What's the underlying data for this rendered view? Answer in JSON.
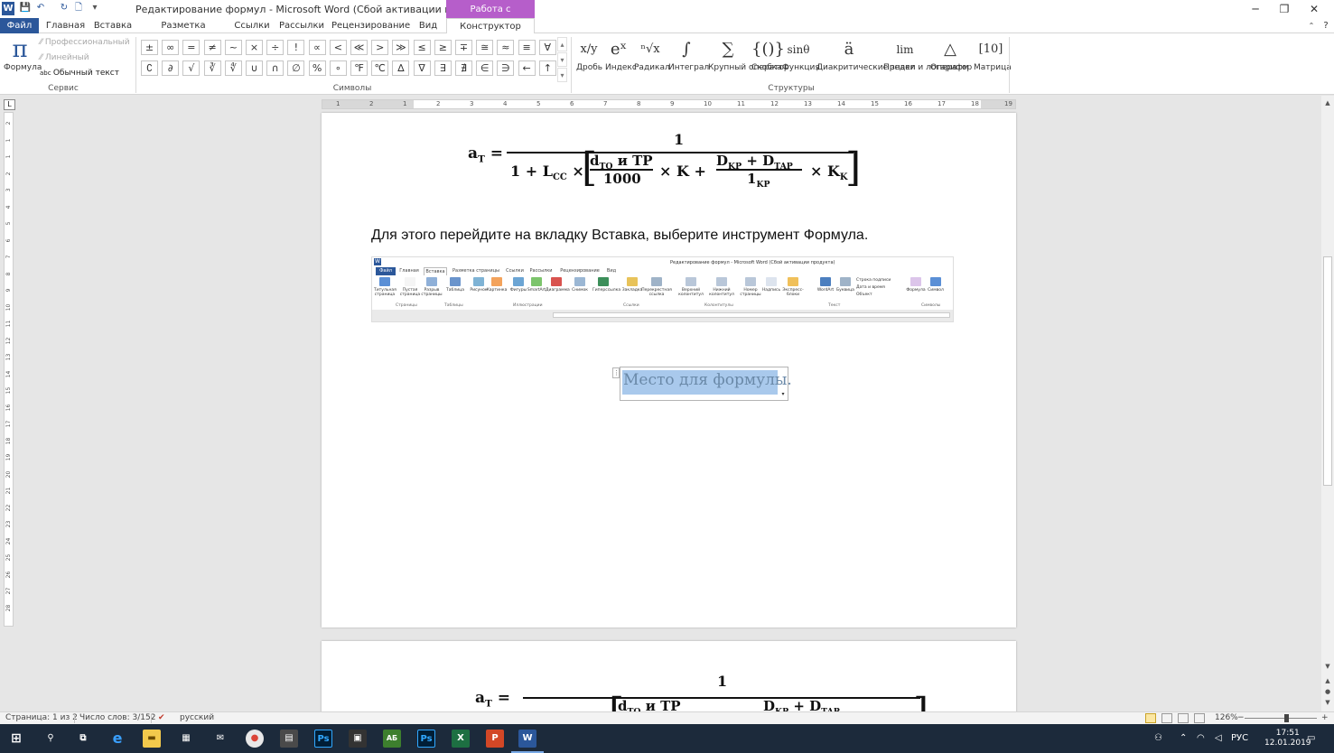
{
  "window": {
    "title": "Редактирование формул  -  Microsoft Word (Сбой активации продукта)",
    "context_group": "Работа с формулами",
    "buttons": [
      "─",
      "❐",
      "✕"
    ]
  },
  "quick_access": {
    "logo": "W",
    "save": "💾",
    "undo": "↶",
    "repeat": "↻",
    "new": "🗋",
    "customize": "▾"
  },
  "tabs": [
    "Файл",
    "Главная",
    "Вставка",
    "Разметка страницы",
    "Ссылки",
    "Рассылки",
    "Рецензирование",
    "Вид",
    "Конструктор"
  ],
  "ribbon": {
    "service": {
      "formula_icon": "π",
      "formula_label": "Формула",
      "professional": "Профессиональный",
      "linear": "Линейный",
      "normal_text": "Обычный текст",
      "group_label": "Сервис"
    },
    "symbols": {
      "row1": [
        "±",
        "∞",
        "=",
        "≠",
        "~",
        "×",
        "÷",
        "!",
        "∝",
        "<",
        "≪",
        ">",
        "≫",
        "≤",
        "≥",
        "∓",
        "≅",
        "≈",
        "≡",
        "∀"
      ],
      "row2": [
        "∁",
        "∂",
        "√",
        "∛",
        "∜",
        "∪",
        "∩",
        "∅",
        "%",
        "∘",
        "℉",
        "℃",
        "∆",
        "∇",
        "∃",
        "∄",
        "∈",
        "∋",
        "←",
        "↑"
      ],
      "group_label": "Символы"
    },
    "structures": {
      "items": [
        {
          "icon": "x/y",
          "label": "Дробь"
        },
        {
          "icon": "eˣ",
          "label": "Индекс"
        },
        {
          "icon": "ⁿ√x",
          "label": "Радикал"
        },
        {
          "icon": "∫",
          "label": "Интеграл"
        },
        {
          "icon": "∑",
          "label": "Крупный оператор"
        },
        {
          "icon": "{()}",
          "label": "Скобка"
        },
        {
          "icon": "sinθ",
          "label": "Функция"
        },
        {
          "icon": "ä",
          "label": "Диакритические знаки"
        },
        {
          "icon": "lim",
          "label": "Предел и логарифм"
        },
        {
          "icon": "△",
          "label": "Оператор"
        },
        {
          "icon": "[10]",
          "label": "Матрица"
        }
      ],
      "group_label": "Структуры"
    }
  },
  "ruler": {
    "ticks": [
      "1",
      "2",
      "1",
      "2",
      "3",
      "4",
      "5",
      "6",
      "7",
      "8",
      "9",
      "10",
      "11",
      "12",
      "13",
      "14",
      "15",
      "16",
      "17",
      "18",
      "19"
    ],
    "vticks": [
      "2",
      "1",
      "1",
      "2",
      "3",
      "4",
      "5",
      "6",
      "7",
      "8",
      "9",
      "10",
      "11",
      "12",
      "13",
      "14",
      "15",
      "16",
      "17",
      "18",
      "19",
      "20",
      "21",
      "22",
      "23",
      "24",
      "25",
      "26",
      "27",
      "28"
    ]
  },
  "document": {
    "formula": {
      "lhs": "a",
      "lhs_sub": "T",
      "numerator": "1",
      "one": "1",
      "plus": "+",
      "l": "L",
      "l_sub": "CC",
      "times": "×",
      "d_to": "d",
      "d_to_sub": "TO",
      "and_tr": " и TP",
      "thousand": "1000",
      "k": "K",
      "dkp": "D",
      "dkp_sub": "KP",
      "dtar": "D",
      "dtar_sub": "TAP",
      "one_kp": "1",
      "one_kp_sub": "KP",
      "kk": "K",
      "kk_sub": "K"
    },
    "body_text": "Для этого перейдите на вкладку Вставка, выберите инструмент Формула.",
    "placeholder": "Место для формулы."
  },
  "embedded_screenshot": {
    "title": "Редактирование формул  -  Microsoft Word (Сбой активации продукта)",
    "tabs": [
      "Файл",
      "Главная",
      "Вставка",
      "Разметка страницы",
      "Ссылки",
      "Рассылки",
      "Рецензирование",
      "Вид"
    ],
    "buttons": [
      "Титульная страница",
      "Пустая страница",
      "Разрыв страницы",
      "Таблица",
      "Рисунок",
      "Картинка",
      "Фигуры",
      "SmartArt",
      "Диаграмма",
      "Снимок",
      "Гиперссылка",
      "Закладка",
      "Перекрестная ссылка",
      "Верхний колонтитул",
      "Нижний колонтитул",
      "Номер страницы",
      "Надпись",
      "Экспресс-блоки",
      "WordArt",
      "Буквица",
      "Формула",
      "Символ"
    ],
    "side_items": [
      "Строка подписи",
      "Дата и время",
      "Объект"
    ],
    "groups": [
      "Страницы",
      "Таблицы",
      "Иллюстрации",
      "Ссылки",
      "Колонтитулы",
      "Текст",
      "Символы"
    ]
  },
  "statusbar": {
    "page": "Страница: 1 из 2",
    "words": "Число слов: 3/152",
    "language": "русский",
    "zoom": "126%",
    "zoom_minus": "−",
    "zoom_plus": "+"
  },
  "taskbar": {
    "language": "РУС",
    "time": "17:51",
    "date": "12.01.2019"
  },
  "colors": {
    "word_blue": "#2b579a",
    "context_purple": "#b65eca",
    "taskbar": "#1c2a3b",
    "selection": "#a9c9ec"
  }
}
